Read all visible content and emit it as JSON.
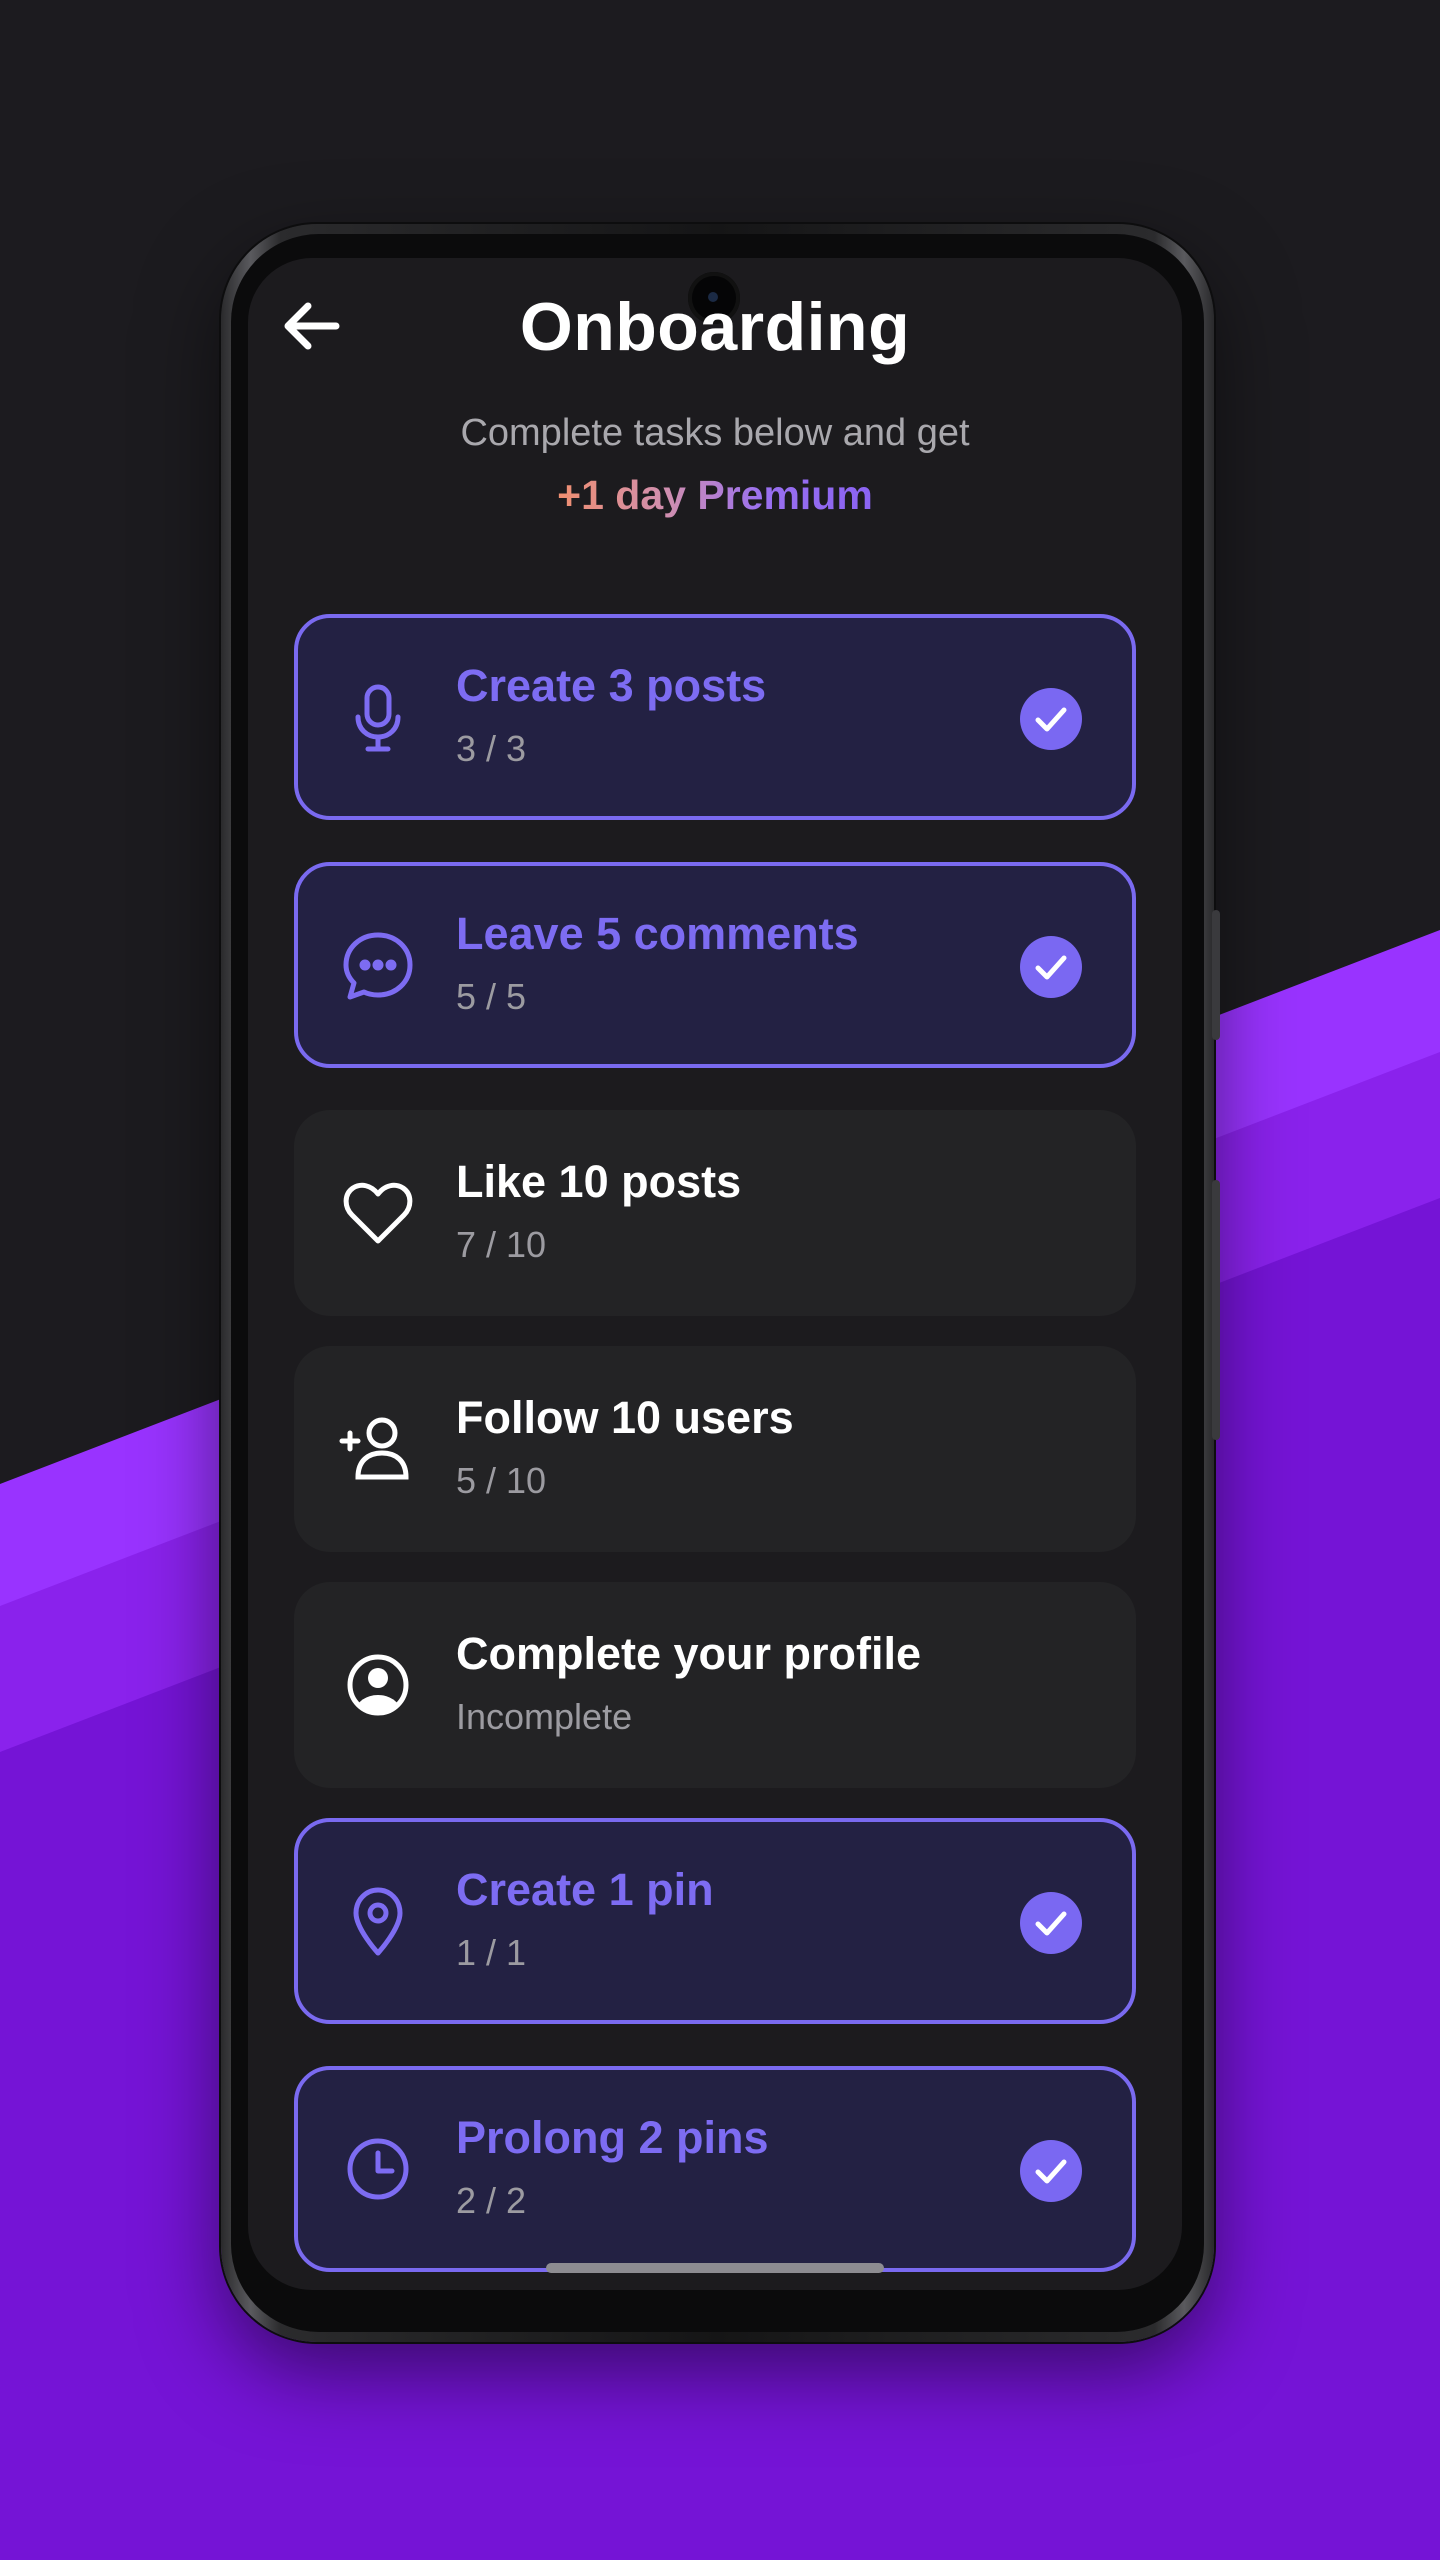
{
  "header": {
    "title": "Onboarding",
    "subtitle": "Complete tasks below and get",
    "reward": "+1 day Premium",
    "back_icon": "arrow-left-icon"
  },
  "tasks": [
    {
      "title": "Create 3 posts",
      "progress": "3 / 3",
      "icon": "microphone-icon",
      "completed": true
    },
    {
      "title": "Leave 5 comments",
      "progress": "5 / 5",
      "icon": "chat-bubble-icon",
      "completed": true
    },
    {
      "title": "Like 10 posts",
      "progress": "7 / 10",
      "icon": "heart-icon",
      "completed": false
    },
    {
      "title": "Follow 10 users",
      "progress": "5 / 10",
      "icon": "add-user-icon",
      "completed": false
    },
    {
      "title": "Complete your profile",
      "progress": "Incomplete",
      "icon": "profile-circle-icon",
      "completed": false
    },
    {
      "title": "Create 1 pin",
      "progress": "1 / 1",
      "icon": "map-pin-icon",
      "completed": true
    },
    {
      "title": "Prolong 2 pins",
      "progress": "2 / 2",
      "icon": "clock-icon",
      "completed": true
    }
  ],
  "colors": {
    "accent": "#7a68f2",
    "completed_card_bg": "#232143",
    "card_bg": "#232325",
    "screen_bg": "#1c1b1e",
    "backdrop_purple": "#7514d6"
  }
}
